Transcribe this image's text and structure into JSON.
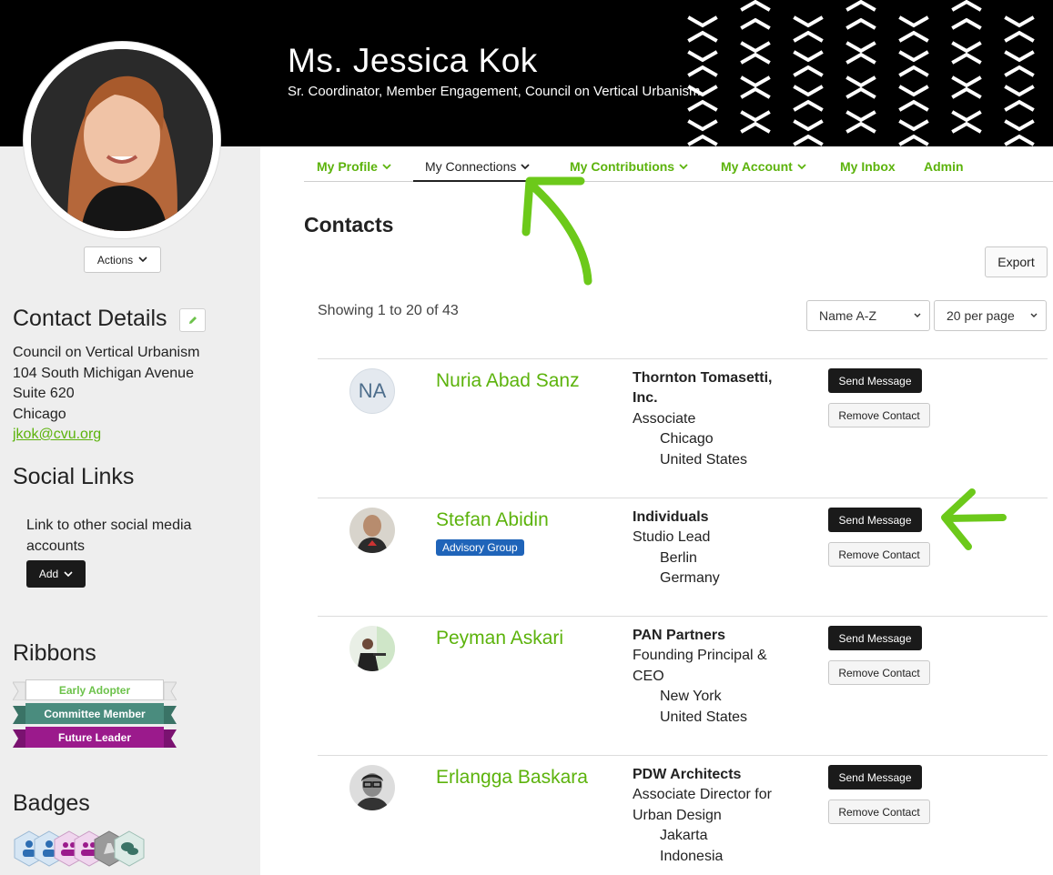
{
  "profile": {
    "name": "Ms. Jessica Kok",
    "title": "Sr. Coordinator, Member Engagement, Council on Vertical Urbanism",
    "actions_label": "Actions"
  },
  "contact_details": {
    "heading": "Contact Details",
    "org": "Council on Vertical Urbanism",
    "street": "104 South Michigan Avenue",
    "suite": "Suite 620",
    "city": "Chicago",
    "email": "jkok@cvu.org"
  },
  "social_links": {
    "heading": "Social Links",
    "text": "Link to other social media accounts",
    "add_label": "Add"
  },
  "ribbons": {
    "heading": "Ribbons",
    "items": [
      {
        "label": "Early Adopter",
        "color": "#ffffff",
        "text_color": "#6cc24a"
      },
      {
        "label": "Committee Member",
        "color": "#4a8c7e",
        "text_color": "#ffffff"
      },
      {
        "label": "Future Leader",
        "color": "#9b1a8c",
        "text_color": "#ffffff"
      }
    ]
  },
  "badges": {
    "heading": "Badges",
    "icons": [
      "person-badge-icon",
      "person-badge-icon",
      "group-badge-icon",
      "group-badge-icon",
      "hand-badge-icon",
      "chat-badge-icon"
    ]
  },
  "nav": {
    "items": [
      {
        "label": "My Profile",
        "dropdown": true
      },
      {
        "label": "My Connections",
        "dropdown": true,
        "active": true
      },
      {
        "label": "My Contributions",
        "dropdown": true
      },
      {
        "label": "My Account",
        "dropdown": true
      },
      {
        "label": "My Inbox",
        "dropdown": false
      },
      {
        "label": "Admin",
        "dropdown": false
      }
    ]
  },
  "contacts": {
    "heading": "Contacts",
    "export_label": "Export",
    "showing": "Showing 1 to 20 of 43",
    "sort_selected": "Name A-Z",
    "per_page_selected": "20 per page",
    "send_label": "Send Message",
    "remove_label": "Remove Contact",
    "list": [
      {
        "initials": "NA",
        "name": "Nuria Abad Sanz",
        "tag": "",
        "org": "Thornton Tomasetti, Inc.",
        "role": "Associate",
        "city": "Chicago",
        "country": "United States"
      },
      {
        "initials": "",
        "name": "Stefan Abidin",
        "tag": "Advisory Group",
        "org": "Individuals",
        "role": "Studio Lead",
        "city": "Berlin",
        "country": "Germany"
      },
      {
        "initials": "",
        "name": "Peyman Askari",
        "tag": "",
        "org": "PAN Partners",
        "role": "Founding Principal & CEO",
        "city": "New York",
        "country": "United States"
      },
      {
        "initials": "",
        "name": "Erlangga Baskara",
        "tag": "",
        "org": "PDW Architects",
        "role": "Associate Director for Urban Design",
        "city": "Jakarta",
        "country": "Indonesia"
      }
    ]
  },
  "colors": {
    "accent": "#5cb30c",
    "annotation": "#6cc91a",
    "tag": "#1f64b9"
  }
}
